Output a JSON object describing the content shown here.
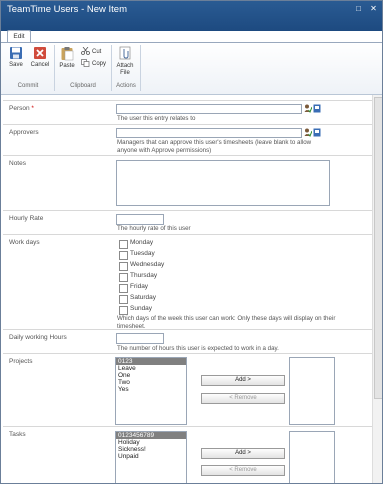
{
  "window": {
    "title": "TeamTime Users - New Item",
    "min_glyph": "□",
    "close_glyph": "✕"
  },
  "ribbon": {
    "tab": "Edit",
    "save": "Save",
    "cancel": "Cancel",
    "paste": "Paste",
    "cut": "Cut",
    "copy": "Copy",
    "attach": "Attach File",
    "groups": {
      "commit": "Commit",
      "clipboard": "Clipboard",
      "actions": "Actions"
    }
  },
  "form": {
    "person": {
      "label": "Person",
      "required": "*",
      "description": "The user this entry relates to"
    },
    "approvers": {
      "label": "Approvers",
      "description": "Managers that can approve this user's timesheets (leave blank to allow anyone with Approve permissions)"
    },
    "notes": {
      "label": "Notes"
    },
    "hourly_rate": {
      "label": "Hourly Rate",
      "description": "The hourly rate of this user"
    },
    "work_days": {
      "label": "Work days",
      "days": [
        "Monday",
        "Tuesday",
        "Wednesday",
        "Thursday",
        "Friday",
        "Saturday",
        "Sunday"
      ],
      "description": "Which days of the week this user can work: Only these days will display on their timesheet."
    },
    "daily_hours": {
      "label": "Daily working Hours",
      "description": "The number of hours this user is expected to work in a day."
    },
    "projects": {
      "label": "Projects",
      "options": [
        "0123",
        "Leave",
        "One",
        "Two",
        "Yes"
      ],
      "add": "Add >",
      "remove": "< Remove"
    },
    "tasks": {
      "label": "Tasks",
      "options": [
        "0123456789",
        "Holiday",
        "Sickness!",
        "Unpaid"
      ],
      "add": "Add >",
      "remove": "< Remove"
    }
  },
  "colors": {
    "title_bar": "#2a5b93",
    "accent": "#1d4a80",
    "required": "#cc0000"
  }
}
